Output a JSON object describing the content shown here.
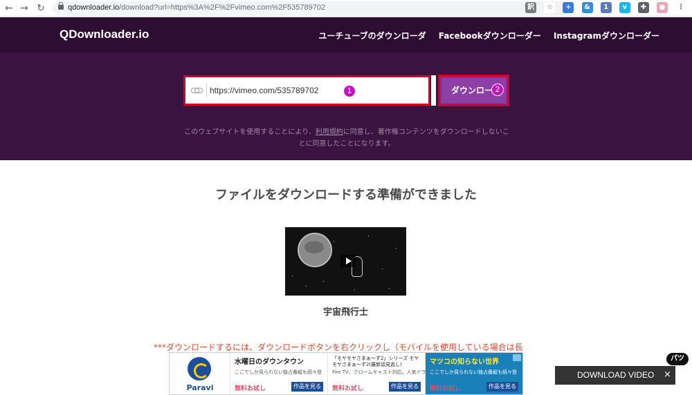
{
  "browser": {
    "url_host": "qdownloader.io",
    "url_path": "/download?url=https%3A%2F%2Fvimeo.com%2F535789702",
    "nav": [
      "back",
      "forward",
      "reload"
    ],
    "extension_icons": [
      "translate-icon",
      "star-icon",
      "ext1-icon",
      "ext2-icon",
      "ext3-icon",
      "vimeo-icon",
      "puzzle-icon",
      "menu-icon",
      "avatar-icon"
    ]
  },
  "header": {
    "logo": "QDownloader.io",
    "nav": [
      "ユーチューブのダウンローダ",
      "Facebookダウンローダー",
      "Instagramダウンローダー"
    ]
  },
  "hero": {
    "url_value": "https://vimeo.com/535789702",
    "badge1": "1",
    "button_label": "ダウンロー",
    "badge2": "2",
    "terms_line1": "このウェブサイトを使用することにより、",
    "terms_link": "利用規約",
    "terms_line2": "に同意し、著作権コンテンツをダウンロードしないことに同意したことになります。"
  },
  "content": {
    "title": "ファイルをダウンロードする準備ができました",
    "video_title": "宇宙飛行士",
    "note": "***ダウンロードするには、ダウンロードボタンを右クリックし（モバイルを使用している場合は長"
  },
  "ads": {
    "paravi_name": "Paravi",
    "ad1": {
      "title": "水曜日のダウンタウン",
      "sub": "ここでしか見られない独占番組も続々登",
      "cta_left": "無料お試し",
      "cta_right": "作品を見る"
    },
    "ad2": {
      "title": "「モヤモヤさまぁ～ず2」シリーズ モヤモヤさまぁ～ず2(最新話見逃し)",
      "sub": "Fire TV、クロームキャスト対応。人気ドラ",
      "cta_left": "無料お試し",
      "cta_right": "作品を見る"
    },
    "ad3": {
      "title": "マツコの知らない世界",
      "sub": "ここでしか見られない独占番組も続々登",
      "cta_left": "無料お試し",
      "cta_right": "作品を見る"
    }
  },
  "floating": {
    "badge": "パツ",
    "label": "DOWNLOAD VIDEO",
    "close": "×"
  },
  "colors": {
    "header_bg": "#2e0d33",
    "hero_bg": "#3b1340",
    "button_bg": "#8e3fa6",
    "highlight": "#d6001c",
    "badge": "#c213c2",
    "note": "#e0492f"
  }
}
